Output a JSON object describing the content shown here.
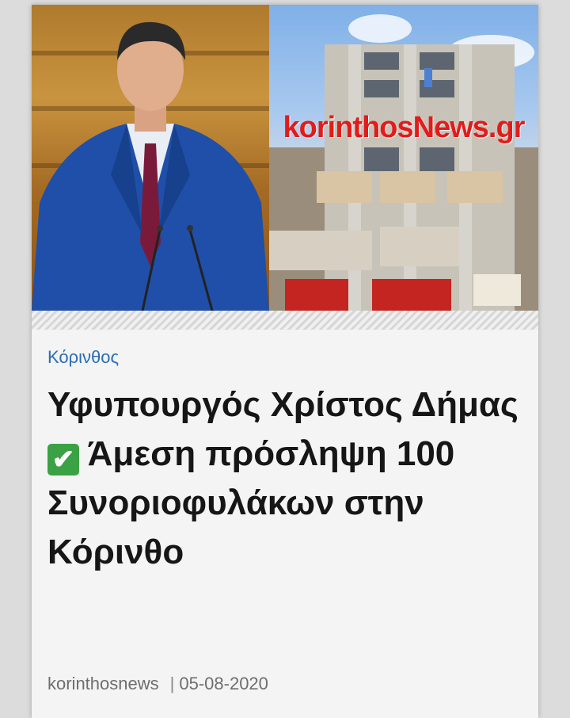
{
  "hero": {
    "watermark": "korinthosNews.gr"
  },
  "article": {
    "category": "Κόρινθος",
    "title_part1": "Υφυπουργός Χρίστος Δήμας",
    "check_mark": "✔",
    "title_part2": "Άμεση πρόσληψη 100 Συνοριοφυλάκων στην Κόρινθο",
    "author": "korinthosnews",
    "separator": "|",
    "date": "05-08-2020"
  },
  "colors": {
    "category": "#2a6db5",
    "watermark": "#e21b1b",
    "check_bg": "#3aa244"
  }
}
